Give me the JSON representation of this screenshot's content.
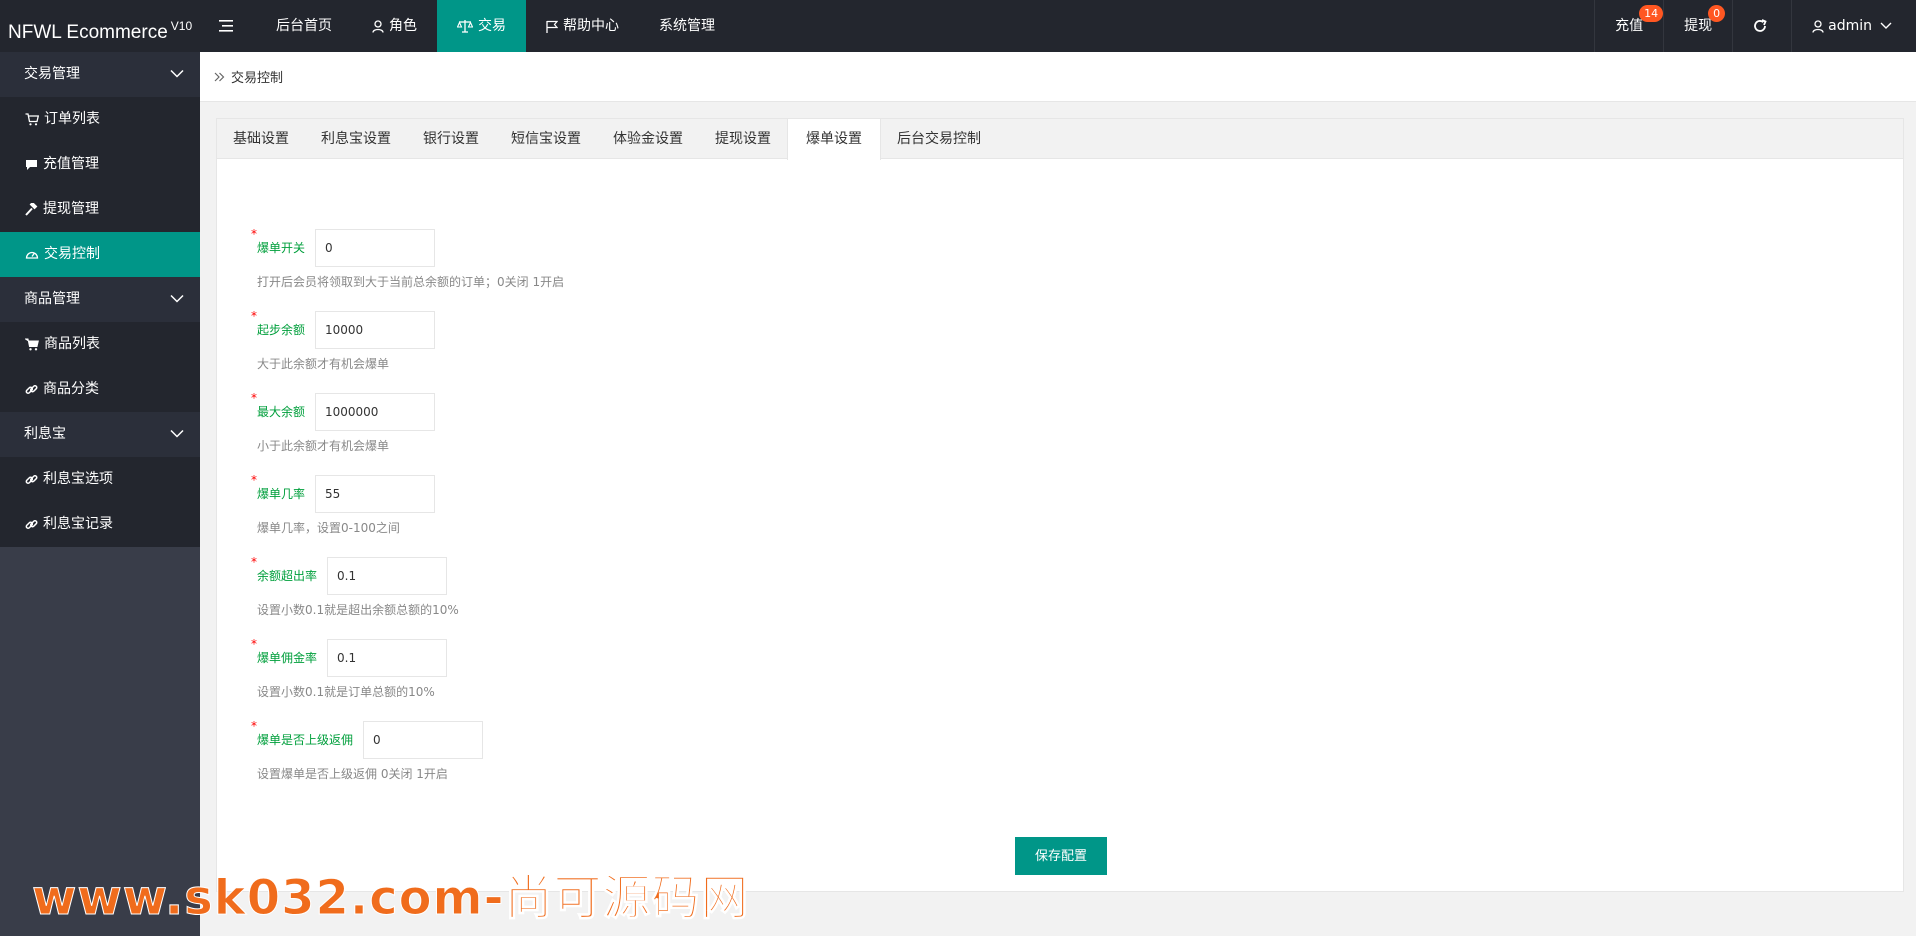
{
  "header": {
    "logo_text": "NFWL Ecommerce",
    "logo_version": "V10",
    "nav": [
      {
        "label": "后台首页"
      },
      {
        "label": "角色",
        "icon": "user-icon"
      },
      {
        "label": "交易",
        "icon": "scale-icon",
        "active": true
      },
      {
        "label": "帮助中心",
        "icon": "flag-icon"
      },
      {
        "label": "系统管理"
      }
    ],
    "right": {
      "recharge_label": "充值",
      "recharge_badge": "14",
      "withdraw_label": "提现",
      "withdraw_badge": "0",
      "user_label": "admin"
    }
  },
  "sidebar": {
    "groups": [
      {
        "label": "交易管理",
        "items": [
          {
            "label": "订单列表",
            "icon": "cart-icon"
          },
          {
            "label": "充值管理",
            "icon": "chat-icon"
          },
          {
            "label": "提现管理",
            "icon": "hammer-icon"
          },
          {
            "label": "交易控制",
            "icon": "dashboard-icon",
            "active": true
          }
        ]
      },
      {
        "label": "商品管理",
        "items": [
          {
            "label": "商品列表",
            "icon": "cart-icon"
          },
          {
            "label": "商品分类",
            "icon": "link-icon"
          }
        ]
      },
      {
        "label": "利息宝",
        "items": [
          {
            "label": "利息宝选项",
            "icon": "link-icon"
          },
          {
            "label": "利息宝记录",
            "icon": "link-icon"
          }
        ]
      }
    ]
  },
  "breadcrumb": {
    "label": "交易控制"
  },
  "tabs": [
    {
      "label": "基础设置"
    },
    {
      "label": "利息宝设置"
    },
    {
      "label": "银行设置"
    },
    {
      "label": "短信宝设置"
    },
    {
      "label": "体验金设置"
    },
    {
      "label": "提现设置"
    },
    {
      "label": "爆单设置",
      "active": true
    },
    {
      "label": "后台交易控制"
    }
  ],
  "form": {
    "fields": [
      {
        "label": "爆单开关",
        "value": "0",
        "hint": "打开后会员将领取到大于当前总余额的订单；0关闭 1开启"
      },
      {
        "label": "起步余额",
        "value": "10000",
        "hint": "大于此余额才有机会爆单"
      },
      {
        "label": "最大余额",
        "value": "1000000",
        "hint": "小于此余额才有机会爆单"
      },
      {
        "label": "爆单几率",
        "value": "55",
        "hint": "爆单几率，设置0-100之间"
      },
      {
        "label": "余额超出率",
        "value": "0.1",
        "hint": "设置小数0.1就是超出余额总额的10%"
      },
      {
        "label": "爆单佣金率",
        "value": "0.1",
        "hint": "设置小数0.1就是订单总额的10%"
      },
      {
        "label": "爆单是否上级返佣",
        "value": "0",
        "hint": "设置爆单是否上级返佣 0关闭 1开启"
      }
    ],
    "save_label": "保存配置"
  },
  "watermark": "www.sk032.com-尚可源码网",
  "colors": {
    "accent": "#009688",
    "header": "#23262e",
    "sidebar": "#393d49",
    "badge": "#ff5722",
    "label": "#009f3c"
  }
}
